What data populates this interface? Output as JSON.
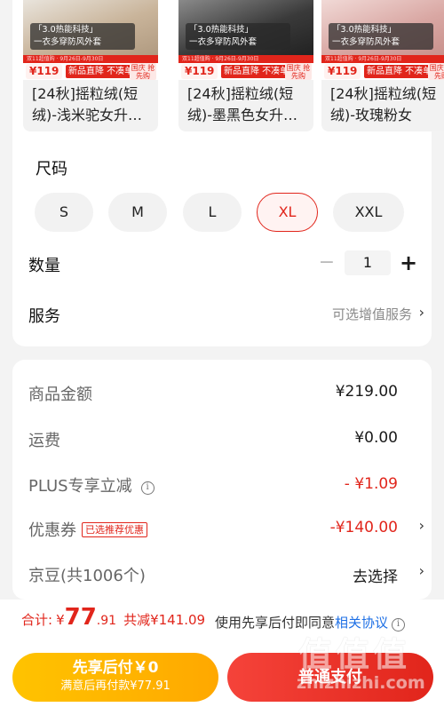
{
  "variants": [
    {
      "tagline_1": "「3.0热能科技」",
      "tagline_2": "一衣多穿防风外套",
      "price": "¥119",
      "promo_bar": "双11超值购 · 9月26日-9月30日",
      "direct_label": "新品直降 不凑单",
      "badge": "国庆 抢先购",
      "name": "[24秋]摇粒绒(短绒)-浅米驼女升…",
      "coat_color": "#c9b49a"
    },
    {
      "tagline_1": "「3.0热能科技」",
      "tagline_2": "一衣多穿防风外套",
      "price": "¥119",
      "promo_bar": "双11超值购 · 9月26日-9月30日",
      "direct_label": "新品直降 不凑单",
      "badge": "国庆 抢先购",
      "name": "[24秋]摇粒绒(短绒)-墨黑色女升…",
      "coat_color": "#3a3a3a"
    },
    {
      "tagline_1": "「3.0热能科技」",
      "tagline_2": "一衣多穿防风外套",
      "price": "¥119",
      "promo_bar": "双11超值购 · 9月26日-9月30日",
      "direct_label": "新品直降 不凑单",
      "badge": "国庆 抢先购",
      "name": "[24秋]摇粒绒(短绒)-玫瑰粉女",
      "coat_color": "#d9a7a3"
    }
  ],
  "size": {
    "label": "尺码",
    "options": [
      "S",
      "M",
      "L",
      "XL",
      "XXL"
    ],
    "selected": "XL"
  },
  "quantity": {
    "label": "数量",
    "value": "1",
    "minus": "−",
    "plus": "+"
  },
  "service": {
    "label": "服务",
    "hint": "可选增值服务",
    "chevron": "›"
  },
  "summary": {
    "goods_amount_label": "商品金额",
    "goods_amount": "¥219.00",
    "shipping_label": "运费",
    "shipping": "¥0.00",
    "plus_label": "PLUS专享立减",
    "plus_value": "- ¥1.09",
    "coupon_label": "优惠券",
    "coupon_tag": "已选推荐优惠",
    "coupon_value": "-¥140.00",
    "jingdou_label": "京豆(共1006个)",
    "jingdou_action": "去选择",
    "info_glyph": "i",
    "chevron": "›"
  },
  "footer": {
    "total_label": "合计:",
    "currency": "¥",
    "total_int": "77",
    "total_dec": ".91",
    "saved": "共减¥141.09",
    "agree_text": "使用先享后付即同意",
    "agree_link": "相关协议",
    "pay_later_label": "先享后付￥0",
    "pay_later_sub": "满意后再付款¥77.91",
    "pay_label": "普通支付"
  },
  "watermark": {
    "glyphs": "值值值",
    "url": "zhizhizhi.com"
  },
  "colors": {
    "accent": "#e1251b",
    "link": "#1d6fe5",
    "pay_later": "#ffb400"
  }
}
